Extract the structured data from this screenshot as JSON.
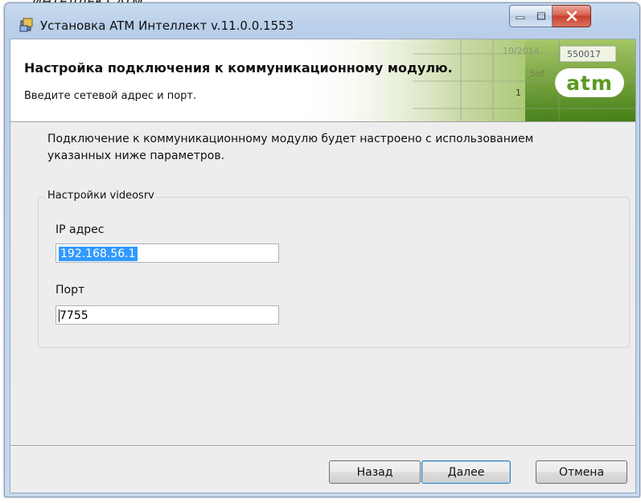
{
  "document": {
    "caption": "ИНТЕЛЛЕКТ ATM"
  },
  "window": {
    "title": "Установка ATM Интеллект v.11.0.0.1553",
    "controls": {
      "minimize": "minimize",
      "maximize": "maximize",
      "close": "close"
    }
  },
  "banner": {
    "heading": "Настройка подключения к коммуникационному модулю.",
    "subheading": "Введите сетевой адрес и порт.",
    "logo_text": "atm",
    "art_texts": [
      "10/2014",
      "550017",
      "Sof",
      "1"
    ]
  },
  "description": "Подключение к коммуникационному модулю будет настроено с использованием указанных ниже параметров.",
  "group": {
    "legend": "Настройки videosrv",
    "ip_label": "IP адрес",
    "ip_value": "192.168.56.1",
    "port_label": "Порт",
    "port_value": "7755"
  },
  "buttons": {
    "back": "Назад",
    "next": "Далее",
    "cancel": "Отмена"
  },
  "colors": {
    "accent_green": "#5a9a1e",
    "selection": "#3399ff",
    "close_red": "#c8402a"
  }
}
